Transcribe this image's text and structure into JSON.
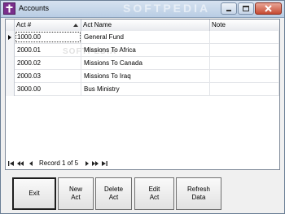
{
  "window": {
    "title": "Accounts",
    "watermark": "SOFTPEDIA",
    "icon": "cross-icon",
    "controls": [
      "minimize-icon",
      "maximize-icon",
      "close-icon"
    ]
  },
  "grid": {
    "columns": [
      "Act #",
      "Act Name",
      "Note"
    ],
    "rows": [
      {
        "act": "1000.00",
        "name": "General Fund",
        "note": ""
      },
      {
        "act": "2000.01",
        "name": "Missions To Africa",
        "note": ""
      },
      {
        "act": "2000.02",
        "name": "Missions To Canada",
        "note": ""
      },
      {
        "act": "2000.03",
        "name": "Missions To Iraq",
        "note": ""
      },
      {
        "act": "3000.00",
        "name": "Bus Ministry",
        "note": ""
      }
    ],
    "watermark": "SOFTPEDIA"
  },
  "navigator": {
    "record_text": "Record 1 of 5",
    "icons": [
      "first-record-icon",
      "previous-page-icon",
      "previous-record-icon",
      "next-record-icon",
      "next-page-icon",
      "last-record-icon"
    ]
  },
  "buttons": {
    "exit": "Exit",
    "new": "New\nAct",
    "delete": "Delete\nAct",
    "edit": "Edit\nAct",
    "refresh": "Refresh\nData"
  }
}
